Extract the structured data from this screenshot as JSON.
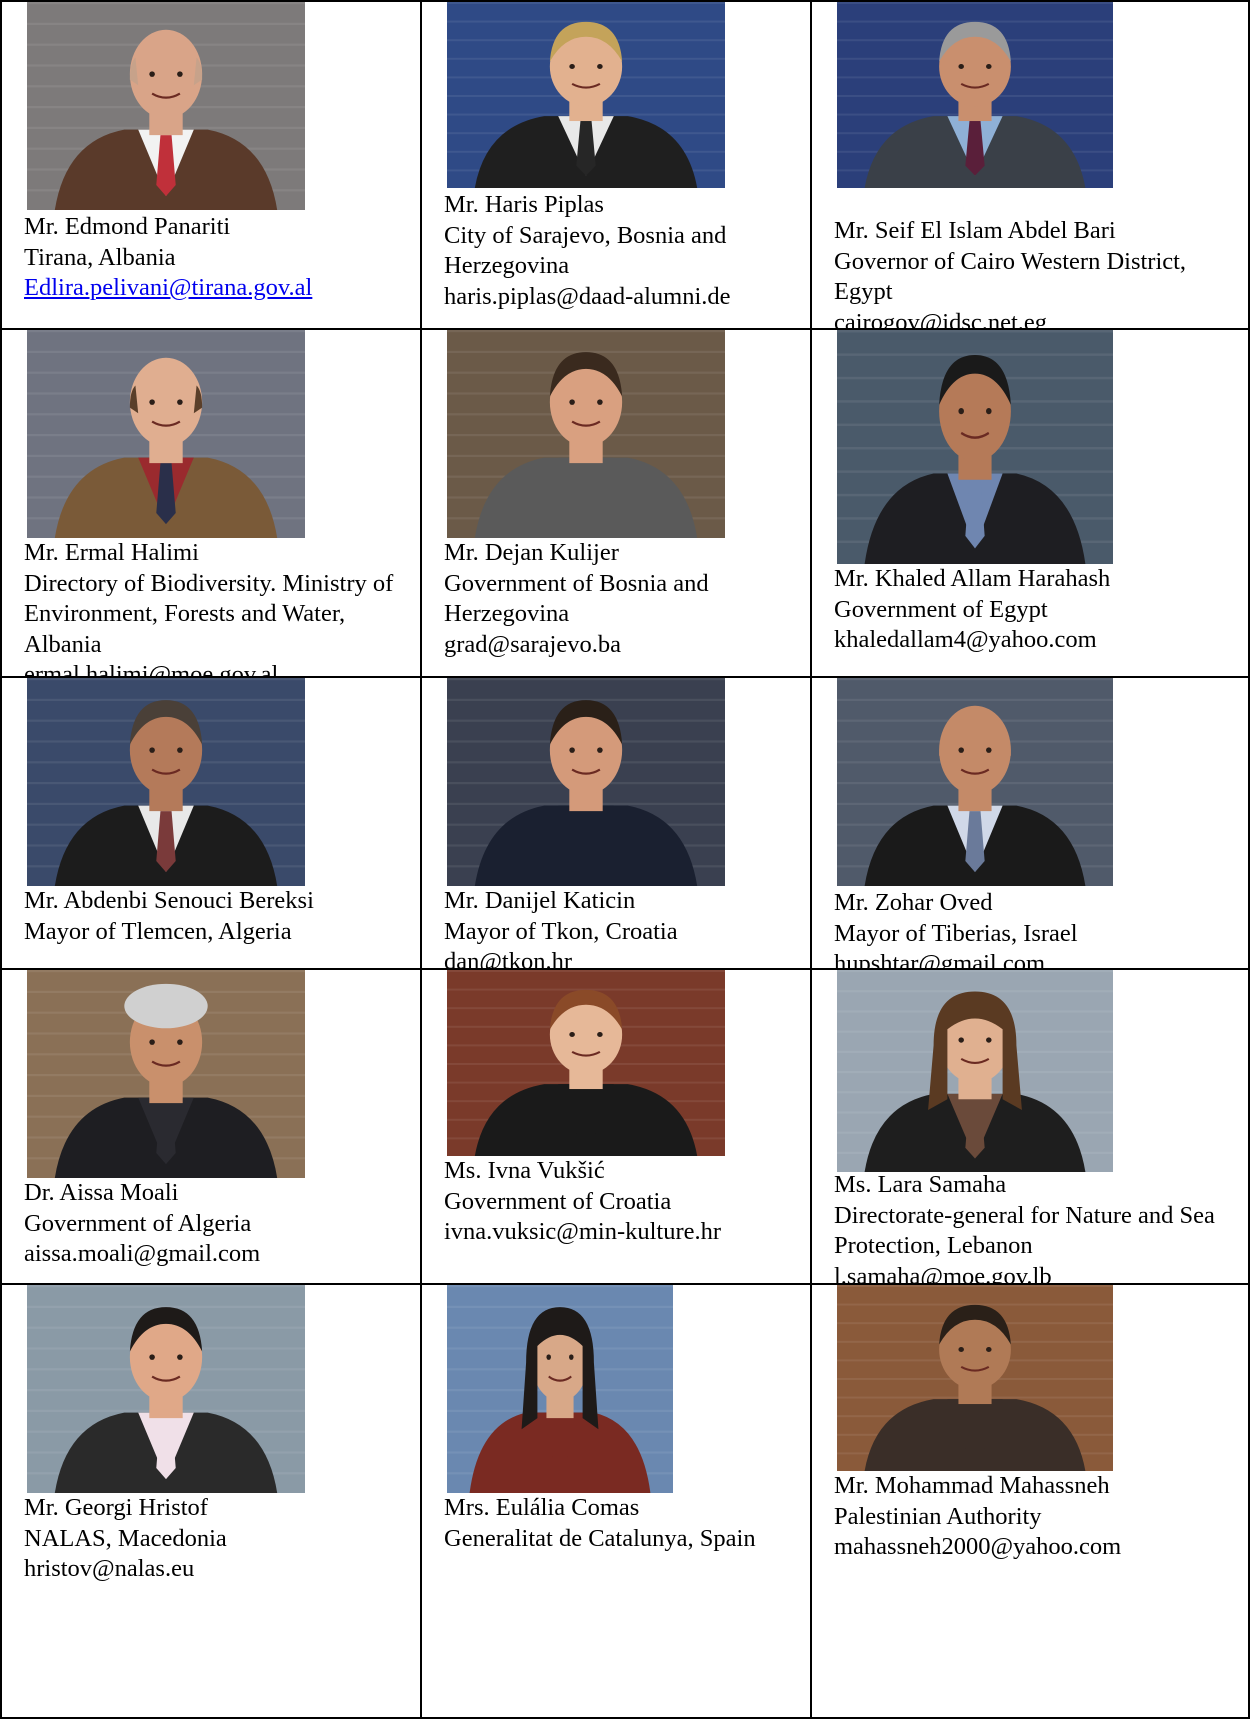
{
  "rows": [
    [
      {
        "name": "Mr. Edmond Panariti",
        "affiliation": "Tirana, Albania",
        "email": "Edlira.pelivani@tirana.gov.al",
        "email_link": true,
        "photo": {
          "bg": "#7d7a7a",
          "suit": "#5a3a2a",
          "shirt": "#f2f2f2",
          "tie": "#c0303a",
          "skin": "#d9a488",
          "hair": "#c7a28a",
          "head": "bald"
        }
      },
      {
        "name": "Mr. Haris Piplas",
        "affiliation": "City of Sarajevo, Bosnia and Herzegovina",
        "email": "haris.piplas@daad-alumni.de",
        "email_link": false,
        "photo": {
          "bg": "#2f4a86",
          "suit": "#1f1f1f",
          "shirt": "#e8e8e8",
          "tie": "#262626",
          "skin": "#e2b18f",
          "hair": "#c4a35a",
          "head": "short"
        }
      },
      {
        "name": "Mr. Seif El Islam Abdel Bari",
        "affiliation": "Governor of Cairo Western District, Egypt",
        "email": "cairogov@idsc.net.eg",
        "email_link": false,
        "photo": {
          "bg": "#2b3f7a",
          "suit": "#3a4048",
          "shirt": "#8fb0d6",
          "tie": "#5a1f3a",
          "skin": "#c98f6e",
          "hair": "#9a9a9a",
          "head": "short"
        }
      }
    ],
    [
      {
        "name": "Mr. Ermal Halimi",
        "affiliation": "Directory of Biodiversity. Ministry of Environment, Forests and Water, Albania",
        "email": "ermal.halimi@moe.gov.al",
        "email_link": false,
        "photo": {
          "bg": "#6f7380",
          "suit": "#7a5a38",
          "shirt": "#9a2a2e",
          "tie": "#2a2f4a",
          "skin": "#e0ae90",
          "hair": "#5a3f2a",
          "head": "bald"
        }
      },
      {
        "name": "Mr. Dejan Kulijer",
        "affiliation": "Government of Bosnia and Herzegovina",
        "email": "grad@sarajevo.ba",
        "email_link": false,
        "photo": {
          "bg": "#6b5a48",
          "suit": "#5a5a5a",
          "shirt": "#5a5a5a",
          "tie": "#5a5a5a",
          "skin": "#d9a080",
          "hair": "#3a2a1e",
          "head": "short"
        }
      },
      {
        "name": "Mr. Khaled Allam Harahash",
        "affiliation": "Government of Egypt",
        "email": "khaledallam4@yahoo.com",
        "email_link": false,
        "photo": {
          "bg": "#4a5a6a",
          "suit": "#1e1e22",
          "shirt": "#6f86b0",
          "tie": "#6f86b0",
          "skin": "#b57a58",
          "hair": "#1a1a1a",
          "head": "short"
        }
      }
    ],
    [
      {
        "name": "Mr. Abdenbi Senouci Bereksi",
        "affiliation": "Mayor of Tlemcen, Algeria",
        "email": "",
        "email_link": false,
        "photo": {
          "bg": "#3a4a6a",
          "suit": "#1c1c1c",
          "shirt": "#e8e8e8",
          "tie": "#7a3a3a",
          "skin": "#b47a5a",
          "hair": "#4a4038",
          "head": "short"
        }
      },
      {
        "name": "Mr. Danijel Katicin",
        "affiliation": "Mayor of Tkon, Croatia",
        "email": "dan@tkon.hr",
        "email_link": false,
        "photo": {
          "bg": "#3a4050",
          "suit": "#1a2030",
          "shirt": "#1a2030",
          "tie": "#1a2030",
          "skin": "#d49a7a",
          "hair": "#2a2018",
          "head": "short"
        }
      },
      {
        "name": "Mr. Zohar Oved",
        "affiliation": "Mayor of Tiberias, Israel",
        "email": "hupshtar@gmail.com",
        "email_link": false,
        "photo": {
          "bg": "#505a6a",
          "suit": "#1a1a1a",
          "shirt": "#d0d8e8",
          "tie": "#6a7a9a",
          "skin": "#c48a68",
          "hair": "#c48a68",
          "head": "bald"
        }
      }
    ],
    [
      {
        "name": "Dr. Aissa Moali",
        "affiliation": "Government of Algeria",
        "email": "aissa.moali@gmail.com",
        "email_link": false,
        "photo": {
          "bg": "#8a7056",
          "suit": "#1e1e22",
          "shirt": "#2a2a30",
          "tie": "#2a2a30",
          "skin": "#c9906c",
          "hair": "#d0d0d0",
          "head": "curly"
        }
      },
      {
        "name": "Ms. Ivna Vukšić",
        "affiliation": "Government of Croatia",
        "email": "ivna.vuksic@min-kulture.hr",
        "email_link": false,
        "photo": {
          "bg": "#7a3a2a",
          "suit": "#1a1a1a",
          "shirt": "#1a1a1a",
          "tie": "#1a1a1a",
          "skin": "#e6b898",
          "hair": "#8a4a28",
          "head": "short"
        }
      },
      {
        "name": "Ms. Lara Samaha",
        "affiliation": "Directorate-general for Nature and Sea Protection, Lebanon",
        "email": "l.samaha@moe.gov.lb",
        "email_link": false,
        "photo": {
          "bg": "#9aa6b2",
          "suit": "#1e1e1e",
          "shirt": "#6a4a3a",
          "tie": "#6a4a3a",
          "skin": "#e0b090",
          "hair": "#5a3a22",
          "head": "long"
        }
      }
    ],
    [
      {
        "name": "Mr. Georgi Hristof",
        "affiliation": "NALAS, Macedonia",
        "email": "hristov@nalas.eu",
        "email_link": false,
        "photo": {
          "bg": "#8a9aa6",
          "suit": "#2a2a2a",
          "shirt": "#f0e0e8",
          "tie": "#f0e0e8",
          "skin": "#e0a888",
          "hair": "#1e1a18",
          "head": "short"
        }
      },
      {
        "name": "Mrs. Eulália Comas",
        "affiliation": "Generalitat de Catalunya, Spain",
        "email": "",
        "email_link": false,
        "photo": {
          "bg": "#6a88b0",
          "suit": "#7a2a22",
          "shirt": "#7a2a22",
          "tie": "#7a2a22",
          "skin": "#d8a888",
          "hair": "#1e1a18",
          "head": "long"
        }
      },
      {
        "name": "Mr. Mohammad Mahassneh",
        "affiliation": "Palestinian Authority",
        "email": "mahassneh2000@yahoo.com",
        "email_link": false,
        "photo": {
          "bg": "#8a5a3a",
          "suit": "#3a2e28",
          "shirt": "#3a2e28",
          "tie": "#3a2e28",
          "skin": "#b07a56",
          "hair": "#2a2018",
          "head": "short"
        }
      }
    ]
  ]
}
